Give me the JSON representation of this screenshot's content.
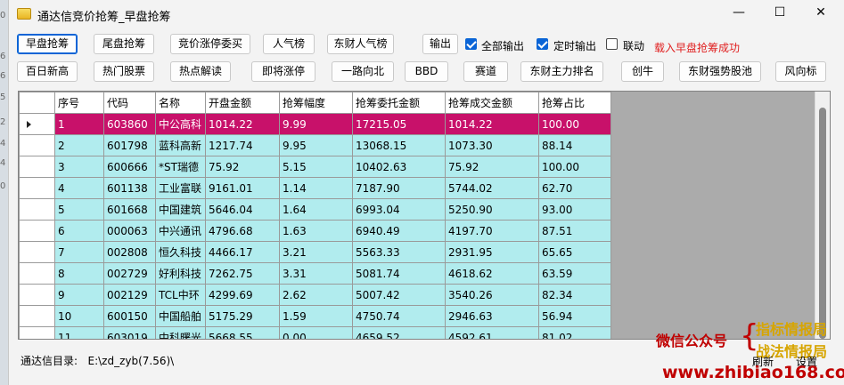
{
  "window": {
    "title": "通达信竞价抢筹_早盘抢筹",
    "controls": {
      "minimize": "—",
      "maximize": "☐",
      "close": "✕"
    }
  },
  "background_edge_digits": [
    "0",
    "6",
    "6",
    "5",
    "2",
    "4",
    "4",
    "0"
  ],
  "toolbar_row1": {
    "buttons": [
      "早盘抢筹",
      "尾盘抢筹",
      "竞价涨停委买",
      "人气榜",
      "东财人气榜",
      "输出"
    ],
    "active": "早盘抢筹",
    "checkboxes": [
      {
        "label": "全部输出",
        "checked": true
      },
      {
        "label": "定时输出",
        "checked": true
      },
      {
        "label": "联动",
        "checked": false
      }
    ],
    "status_message": "载入早盘抢筹成功"
  },
  "toolbar_row2": {
    "buttons": [
      "百日新高",
      "热门股票",
      "热点解读",
      "即将涨停",
      "一路向北",
      "BBD",
      "赛道",
      "东财主力排名",
      "创牛",
      "东财强势股池",
      "风向标"
    ]
  },
  "table": {
    "columns": [
      "序号",
      "代码",
      "名称",
      "开盘金额",
      "抢筹幅度",
      "抢筹委托金额",
      "抢筹成交金额",
      "抢筹占比"
    ],
    "selected_row": 0,
    "rows": [
      [
        "1",
        "603860",
        "中公高科",
        "1014.22",
        "9.99",
        "17215.05",
        "1014.22",
        "100.00"
      ],
      [
        "2",
        "601798",
        "蓝科高新",
        "1217.74",
        "9.95",
        "13068.15",
        "1073.30",
        "88.14"
      ],
      [
        "3",
        "600666",
        "*ST瑞德",
        "75.92",
        "5.15",
        "10402.63",
        "75.92",
        "100.00"
      ],
      [
        "4",
        "601138",
        "工业富联",
        "9161.01",
        "1.14",
        "7187.90",
        "5744.02",
        "62.70"
      ],
      [
        "5",
        "601668",
        "中国建筑",
        "5646.04",
        "1.64",
        "6993.04",
        "5250.90",
        "93.00"
      ],
      [
        "6",
        "000063",
        "中兴通讯",
        "4796.68",
        "1.63",
        "6940.49",
        "4197.70",
        "87.51"
      ],
      [
        "7",
        "002808",
        "恒久科技",
        "4466.17",
        "3.21",
        "5563.33",
        "2931.95",
        "65.65"
      ],
      [
        "8",
        "002729",
        "好利科技",
        "7262.75",
        "3.31",
        "5081.74",
        "4618.62",
        "63.59"
      ],
      [
        "9",
        "002129",
        "TCL中环",
        "4299.69",
        "2.62",
        "5007.42",
        "3540.26",
        "82.34"
      ],
      [
        "10",
        "600150",
        "中国船舶",
        "5175.29",
        "1.59",
        "4750.74",
        "2946.63",
        "56.94"
      ],
      [
        "11",
        "603019",
        "中科曙光",
        "5668.55",
        "0.00",
        "4659.52",
        "4592.61",
        "81.02"
      ]
    ]
  },
  "footer": {
    "dir_label": "通达信目录:",
    "dir_value": "E:\\zd_zyb(7.56)\\",
    "refresh": "刷新",
    "settings": "设置"
  },
  "watermark": {
    "line1": "微信公众号",
    "opt1": "指标情报局",
    "opt2": "战法情报局",
    "site": "www.zhibiao168.com"
  },
  "colors": {
    "selected_row": "#c8116a",
    "row_bg": "#b1ecee",
    "status_red": "#e02020",
    "checkbox_blue": "#0a64d6"
  }
}
